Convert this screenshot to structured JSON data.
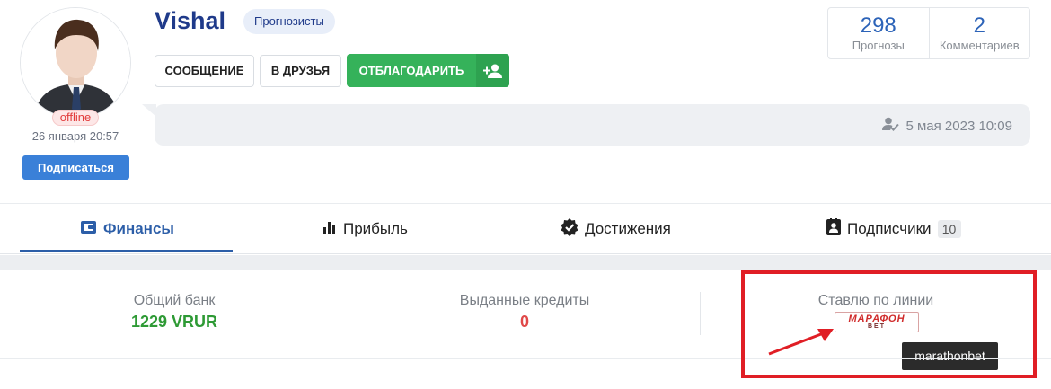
{
  "profile": {
    "username": "Vishal",
    "role": "Прогнозисты",
    "status": "offline",
    "last_seen": "26 января 20:57",
    "subscribe_label": "Подписаться"
  },
  "actions": {
    "message_label": "СООБЩЕНИЕ",
    "friends_label": "В ДРУЗЬЯ",
    "thank_label": "ОТБЛАГОДАРИТЬ"
  },
  "stats": [
    {
      "value": "298",
      "label": "Прогнозы"
    },
    {
      "value": "2",
      "label": "Комментариев"
    }
  ],
  "post": {
    "date": "5 мая 2023 10:09"
  },
  "tabs": [
    {
      "label": "Финансы",
      "icon": "wallet-icon",
      "active": true
    },
    {
      "label": "Прибыль",
      "icon": "bar-chart-icon",
      "active": false
    },
    {
      "label": "Достижения",
      "icon": "badge-check-icon",
      "active": false
    },
    {
      "label": "Подписчики",
      "icon": "contact-card-icon",
      "active": false,
      "badge": "10"
    }
  ],
  "finance": {
    "bank_label": "Общий банк",
    "bank_value": "1229 VRUR",
    "credits_label": "Выданные кредиты",
    "credits_value": "0",
    "line_label": "Ставлю по линии",
    "bookmaker_logo_main": "МАРАФОН",
    "bookmaker_logo_sub": "BET",
    "tooltip": "marathonbet"
  },
  "colors": {
    "accent_blue": "#2c5ea8",
    "green": "#35b25a",
    "bank_value_green": "#2e9a35",
    "credits_value_red": "#e04848",
    "highlight_red": "#e01e25"
  }
}
